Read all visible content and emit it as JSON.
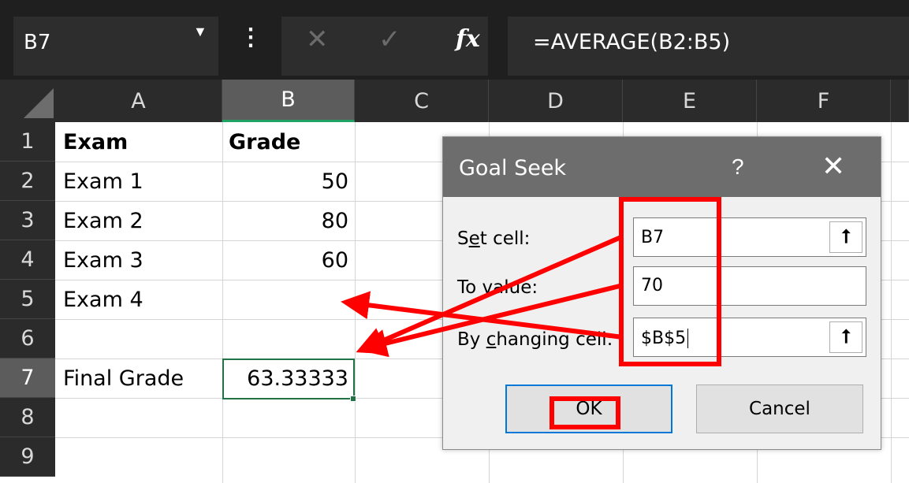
{
  "formula_bar": {
    "name_box": "B7",
    "formula": "=AVERAGE(B2:B5)",
    "fx_label": "fx",
    "more_icon": "vertical-ellipsis-icon",
    "cancel_icon": "x-icon",
    "enter_icon": "check-icon"
  },
  "columns": [
    "A",
    "B",
    "C",
    "D",
    "E",
    "F"
  ],
  "rows": [
    "1",
    "2",
    "3",
    "4",
    "5",
    "6",
    "7",
    "8",
    "9"
  ],
  "cells": {
    "A1": "Exam",
    "B1": "Grade",
    "A2": "Exam 1",
    "B2": "50",
    "A3": "Exam 2",
    "B3": "80",
    "A4": "Exam 3",
    "B4": "60",
    "A5": "Exam 4",
    "B5": "",
    "A7": "Final Grade",
    "B7": "63.33333"
  },
  "selection": {
    "active_cell": "B7",
    "active_column": "B",
    "active_row": "7"
  },
  "dialog": {
    "title": "Goal Seek",
    "help": "?",
    "close": "✕",
    "set_cell_label_pre": "S",
    "set_cell_label_u": "e",
    "set_cell_label_post": "t cell:",
    "set_cell_value": "B7",
    "to_value_label": "To value:",
    "to_value_value": "70",
    "by_changing_label_pre": "By ",
    "by_changing_label_u": "c",
    "by_changing_label_post": "hanging cell:",
    "by_changing_value": "$B$5",
    "ok_label": "OK",
    "cancel_label": "Cancel",
    "ref_icon": "collapse-dialog-icon"
  },
  "colors": {
    "accent": "#217346",
    "annotation": "#ff0000",
    "title_bar": "#6d6d6d",
    "default_button_border": "#0078d7"
  }
}
